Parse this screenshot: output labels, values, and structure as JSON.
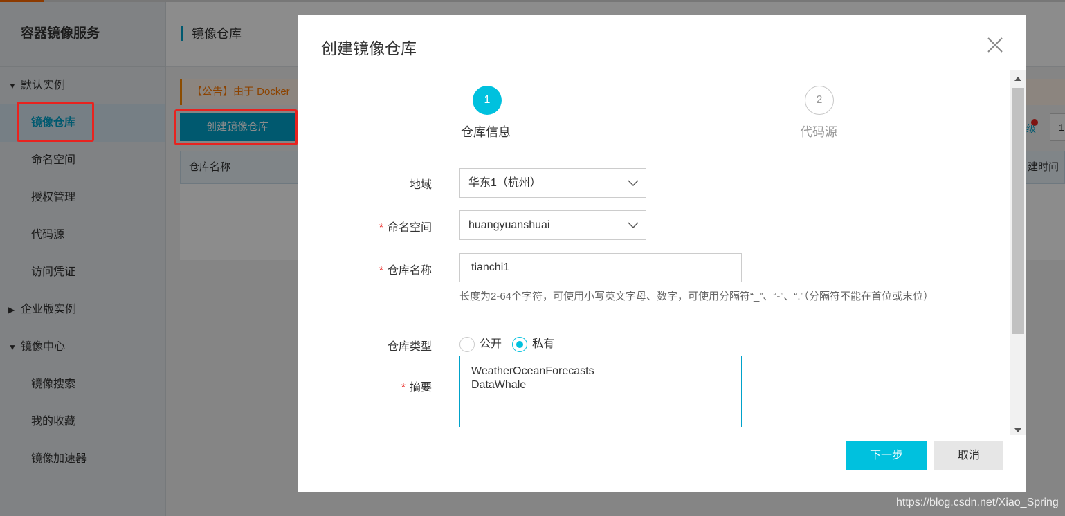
{
  "sidebar": {
    "title": "容器镜像服务",
    "groups": [
      {
        "label": "默认实例",
        "expanded": true,
        "items": [
          "镜像仓库",
          "命名空间",
          "授权管理",
          "代码源",
          "访问凭证"
        ]
      },
      {
        "label": "企业版实例",
        "expanded": false,
        "items": []
      },
      {
        "label": "镜像中心",
        "expanded": true,
        "items": [
          "镜像搜索",
          "我的收藏",
          "镜像加速器"
        ]
      }
    ],
    "active_item": "镜像仓库"
  },
  "main": {
    "title": "镜像仓库",
    "notice": "【公告】由于 Docker",
    "create_button": "创建镜像仓库",
    "table_header_left": "仓库名称",
    "table_header_right": "建时间",
    "right_link_fragment": "级",
    "right_input_value": "1"
  },
  "modal": {
    "title": "创建镜像仓库",
    "steps": [
      {
        "number": "1",
        "label": "仓库信息",
        "active": true
      },
      {
        "number": "2",
        "label": "代码源",
        "active": false
      }
    ],
    "region": {
      "label": "地域",
      "value": "华东1（杭州）",
      "required": false
    },
    "namespace": {
      "label": "命名空间",
      "value": "huangyuanshuai",
      "required": true
    },
    "repo_name": {
      "label": "仓库名称",
      "value": "tianchi1",
      "required": true,
      "hint": "长度为2-64个字符，可使用小写英文字母、数字，可使用分隔符“_”、“-”、“.”（分隔符不能在首位或末位）"
    },
    "repo_type": {
      "label": "仓库类型",
      "options": [
        "公开",
        "私有"
      ],
      "selected": "私有"
    },
    "summary": {
      "label": "摘要",
      "value": "WeatherOceanForecasts\nDataWhale",
      "required": true
    },
    "next_button": "下一步",
    "cancel_button": "取消"
  },
  "watermark": "https://blog.csdn.net/Xiao_Spring",
  "colors": {
    "accent": "#00a2ca",
    "step_active": "#00c1de",
    "highlight_box": "#e8231f",
    "notice": "#ff7a00"
  }
}
